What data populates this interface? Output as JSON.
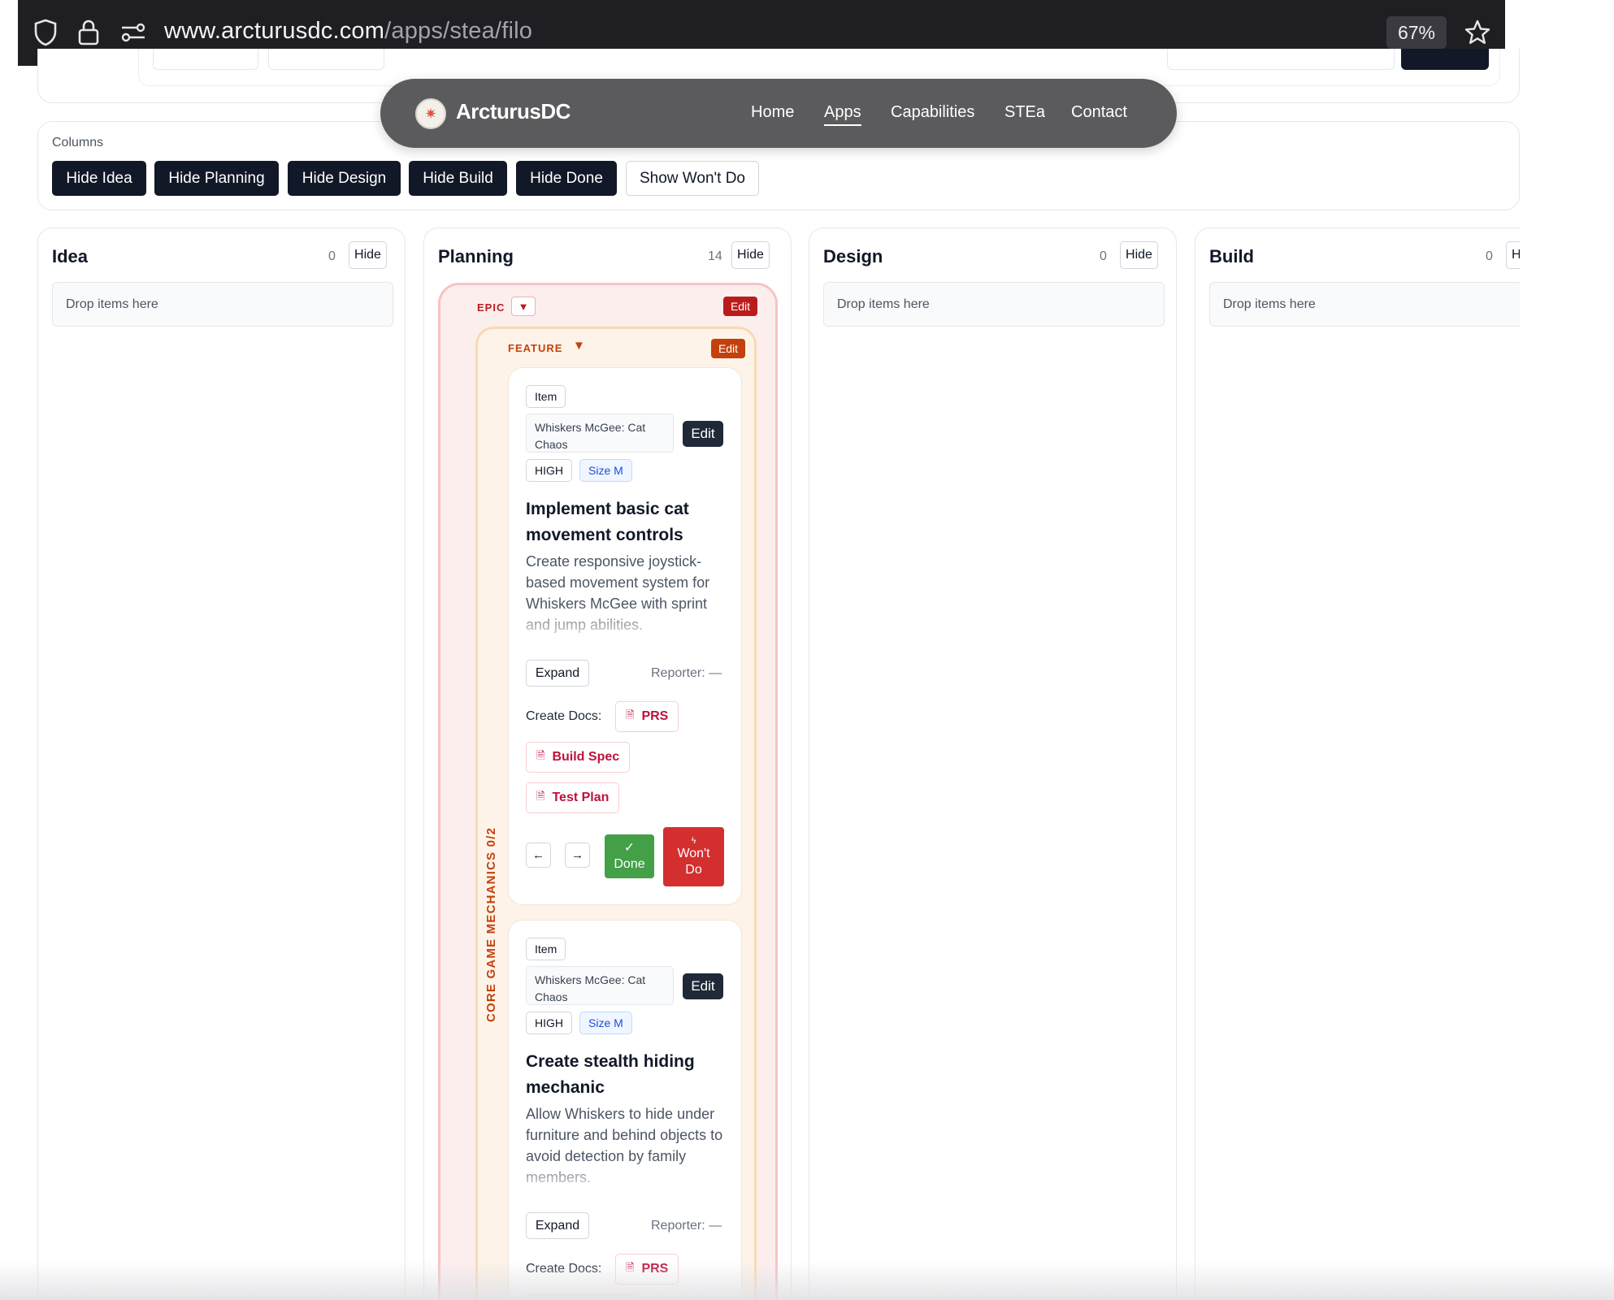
{
  "browser": {
    "url_host": "www.arcturusdc.com",
    "url_path": "/apps/stea/filo",
    "zoom": "67%"
  },
  "nav": {
    "brand": "ArcturusDC",
    "links": [
      "Home",
      "Apps",
      "Capabilities",
      "STEa",
      "Contact"
    ],
    "active": "Apps"
  },
  "columns_panel": {
    "label": "Columns",
    "buttons": [
      "Hide Idea",
      "Hide Planning",
      "Hide Design",
      "Hide Build",
      "Hide Done",
      "Show Won't Do"
    ]
  },
  "board": {
    "columns": [
      {
        "title": "Idea",
        "count": "0",
        "hide": "Hide",
        "drop": "Drop items here"
      },
      {
        "title": "Planning",
        "count": "14",
        "hide": "Hide"
      },
      {
        "title": "Design",
        "count": "0",
        "hide": "Hide",
        "drop": "Drop items here"
      },
      {
        "title": "Build",
        "count": "0",
        "hide": "Hide",
        "drop": "Drop items here"
      }
    ]
  },
  "epic": {
    "tag": "EPIC",
    "toggle": "▼",
    "edit": "Edit"
  },
  "feature": {
    "tag": "FEATURE",
    "toggle": "▼",
    "edit": "Edit",
    "name": "CORE GAME MECHANICS 0/2"
  },
  "items": [
    {
      "type": "Item",
      "project": "Whiskers McGee: Cat Chaos",
      "edit": "Edit",
      "priority": "HIGH",
      "size": "Size M",
      "title": "Implement basic cat movement controls",
      "description": "Create responsive joystick-based movement system for Whiskers McGee with sprint and jump abilities.",
      "expand": "Expand",
      "reporter": "Reporter: —",
      "docs_label": "Create Docs:",
      "docs": [
        "PRS",
        "Build Spec",
        "Test Plan"
      ],
      "prev": "←",
      "next": "→",
      "done_icon": "✓",
      "done": "Done",
      "wont_icon": "ϟ",
      "wont_line1": "Won't",
      "wont_line2": "Do"
    },
    {
      "type": "Item",
      "project": "Whiskers McGee: Cat Chaos",
      "edit": "Edit",
      "priority": "HIGH",
      "size": "Size M",
      "title": "Create stealth hiding mechanic",
      "description": "Allow Whiskers to hide under furniture and behind objects to avoid detection by family members.",
      "expand": "Expand",
      "reporter": "Reporter: —",
      "docs_label": "Create Docs:",
      "docs": [
        "PRS"
      ]
    }
  ]
}
